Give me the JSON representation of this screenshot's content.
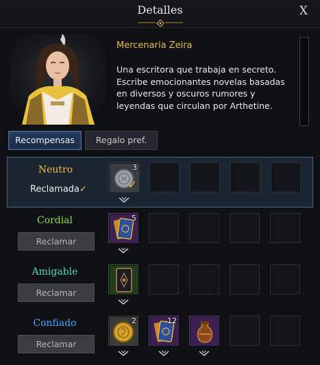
{
  "header": {
    "title": "Detalles",
    "close_label": "X",
    "background_ghost_text": "Arthetine"
  },
  "npc": {
    "name": "Mercenaria Zeira",
    "description": "Una escritora que trabaja en secreto. Escribe emocionantes novelas basadas en diversos y oscuros rumores y leyendas que circulan por Arthetine."
  },
  "tabs": [
    {
      "label": "Recompensas",
      "active": true
    },
    {
      "label": "Regalo pref.",
      "active": false
    }
  ],
  "tiers": [
    {
      "label": "Neutro",
      "color": "#f0b83a",
      "status": "Reclamada",
      "claimed": true,
      "rewards": [
        {
          "icon": "silver-coin-icon",
          "count": "3",
          "claimed": true
        }
      ]
    },
    {
      "label": "Cordial",
      "color": "#8fd94a",
      "button": "Reclamar",
      "claimed": false,
      "rewards": [
        {
          "icon": "card-pack-icon",
          "count": "5"
        }
      ]
    },
    {
      "label": "Amigable",
      "color": "#52d7b4",
      "button": "Reclamar",
      "claimed": false,
      "rewards": [
        {
          "icon": "card-icon",
          "count": ""
        }
      ]
    },
    {
      "label": "Confiado",
      "color": "#3ea6ff",
      "button": "Reclamar",
      "claimed": false,
      "rewards": [
        {
          "icon": "gold-coin-icon",
          "count": "2"
        },
        {
          "icon": "card-pack-icon",
          "count": "12"
        },
        {
          "icon": "potion-pouch-icon",
          "count": ""
        }
      ]
    }
  ],
  "colors": {
    "accent_gold": "#e7b94a",
    "active_tab": "#4f6e9c",
    "selected_row_border": "#4d6787"
  }
}
